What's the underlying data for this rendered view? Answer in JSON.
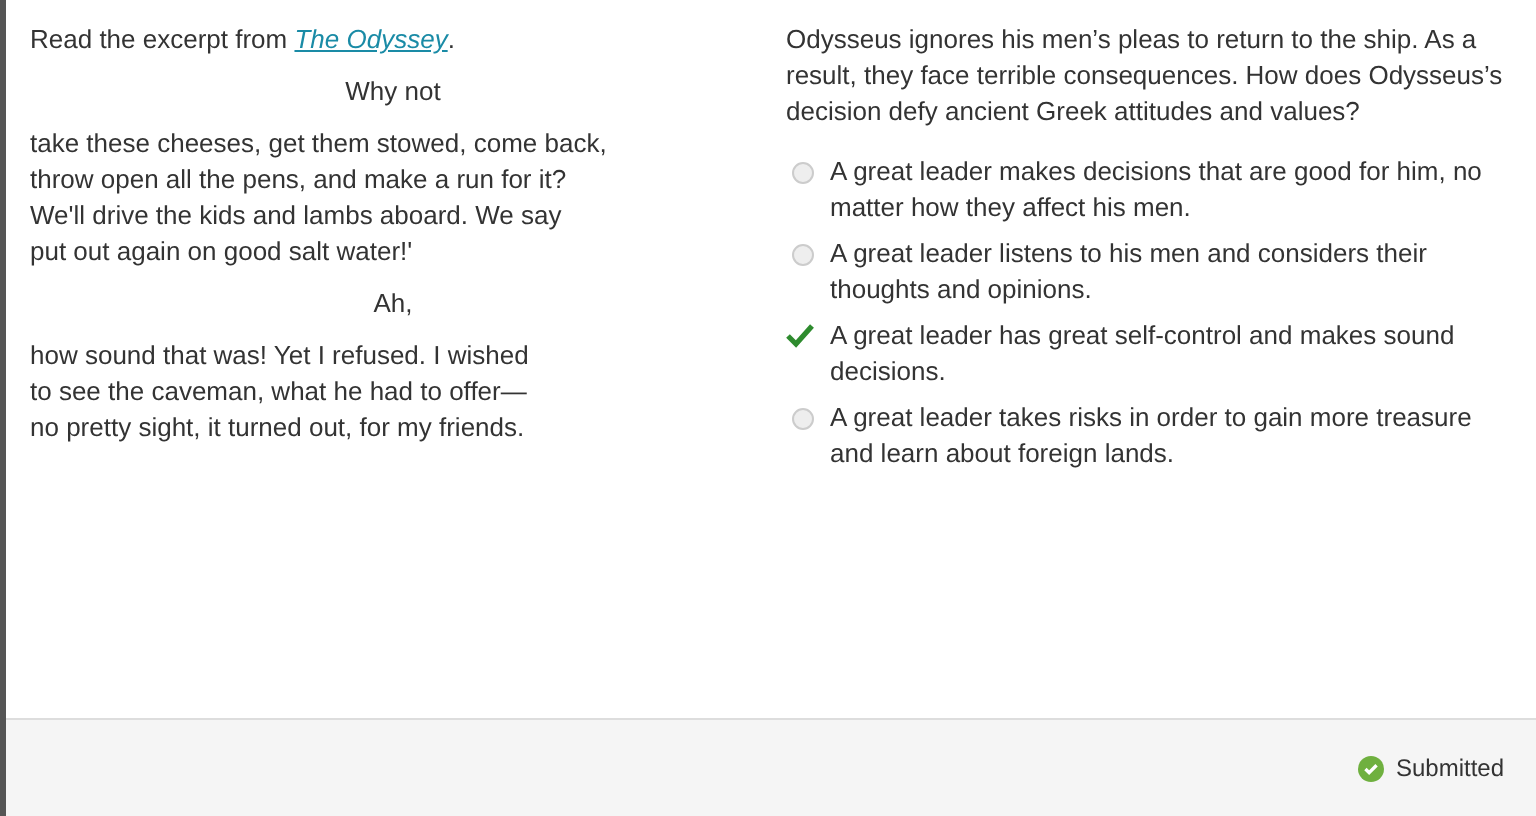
{
  "passage": {
    "intro": "Read the excerpt from ",
    "title_link": "The Odyssey",
    "intro_end": ".",
    "stanzas": [
      {
        "kind": "centered",
        "text": "Why not"
      },
      {
        "kind": "lines",
        "lines": [
          "take these cheeses, get them stowed, come back,",
          "throw open all the pens, and make a run for it?",
          "We'll drive the kids and lambs aboard. We say",
          "put out again on good salt water!'"
        ]
      },
      {
        "kind": "centered",
        "text": "Ah,"
      },
      {
        "kind": "lines",
        "lines": [
          "how sound that was! Yet I refused. I wished",
          "to see the caveman, what he had to offer—",
          "no pretty sight, it turned out, for my friends."
        ]
      }
    ]
  },
  "question": {
    "prompt": "Odysseus ignores his men’s pleas to return to the ship. As a result, they face terrible consequences. How does Odysseus’s decision defy ancient Greek attitudes and values?",
    "options": [
      {
        "text": "A great leader makes decisions that are good for him, no matter how they affect his men.",
        "selected": false
      },
      {
        "text": "A great leader listens to his men and considers their thoughts and opinions.",
        "selected": false
      },
      {
        "text": "A great leader has great self-control and makes sound decisions.",
        "selected": true
      },
      {
        "text": "A great leader takes risks in order to gain more treasure and learn about  foreign lands.",
        "selected": false
      }
    ]
  },
  "status": {
    "text": "Submitted"
  }
}
